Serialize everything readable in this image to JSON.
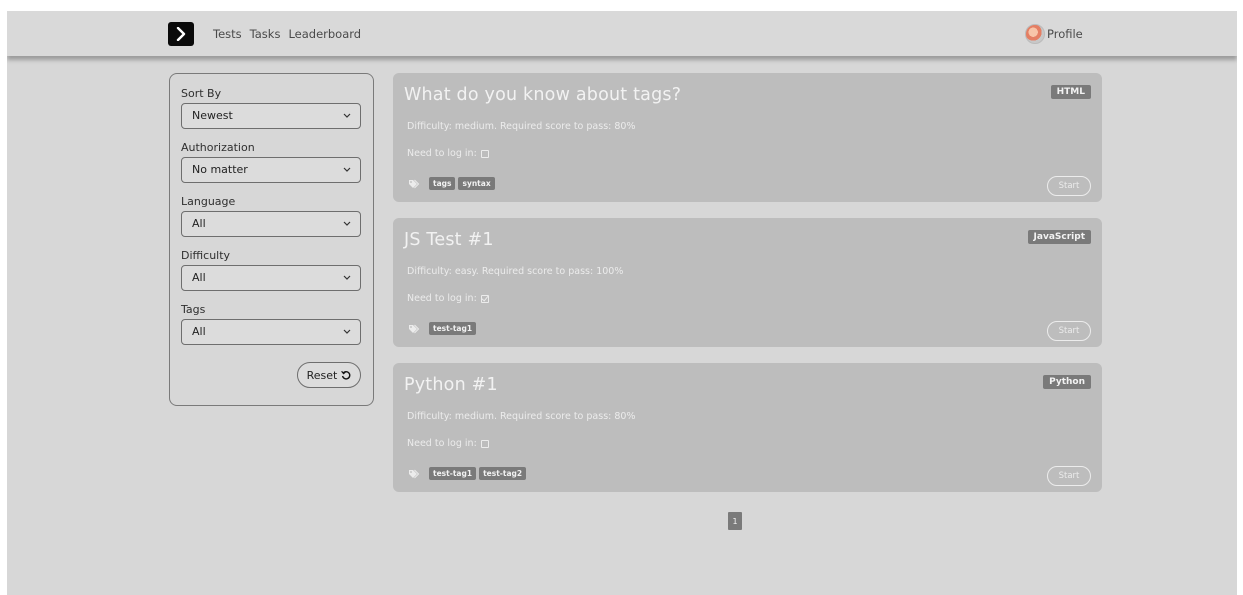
{
  "nav": {
    "logo_icon": "chevron-right-icon",
    "links": [
      "Tests",
      "Tasks",
      "Leaderboard"
    ],
    "profile_label": "Profile"
  },
  "filters": {
    "sort_by": {
      "label": "Sort By",
      "value": "Newest"
    },
    "authorization": {
      "label": "Authorization",
      "value": "No matter"
    },
    "language": {
      "label": "Language",
      "value": "All"
    },
    "difficulty": {
      "label": "Difficulty",
      "value": "All"
    },
    "tags": {
      "label": "Tags",
      "value": "All"
    },
    "reset_label": "Reset"
  },
  "tests": [
    {
      "title": "What do you know about tags?",
      "language": "HTML",
      "details": "Difficulty: medium. Required score to pass: 80%",
      "login_label": "Need to log in:",
      "login_required": false,
      "tags": [
        "tags",
        "syntax"
      ],
      "start_label": "Start"
    },
    {
      "title": "JS Test #1",
      "language": "JavaScript",
      "details": "Difficulty: easy. Required score to pass: 100%",
      "login_label": "Need to log in:",
      "login_required": true,
      "tags": [
        "test-tag1"
      ],
      "start_label": "Start"
    },
    {
      "title": "Python #1",
      "language": "Python",
      "details": "Difficulty: medium. Required score to pass: 80%",
      "login_label": "Need to log in:",
      "login_required": false,
      "tags": [
        "test-tag1",
        "test-tag2"
      ],
      "start_label": "Start"
    }
  ],
  "pagination": {
    "current_page": "1"
  },
  "colors": {
    "background": "#d7d7d7",
    "card": "#bdbdbd",
    "badge": "#7a7a7a",
    "logo": "#0a0a0a"
  }
}
